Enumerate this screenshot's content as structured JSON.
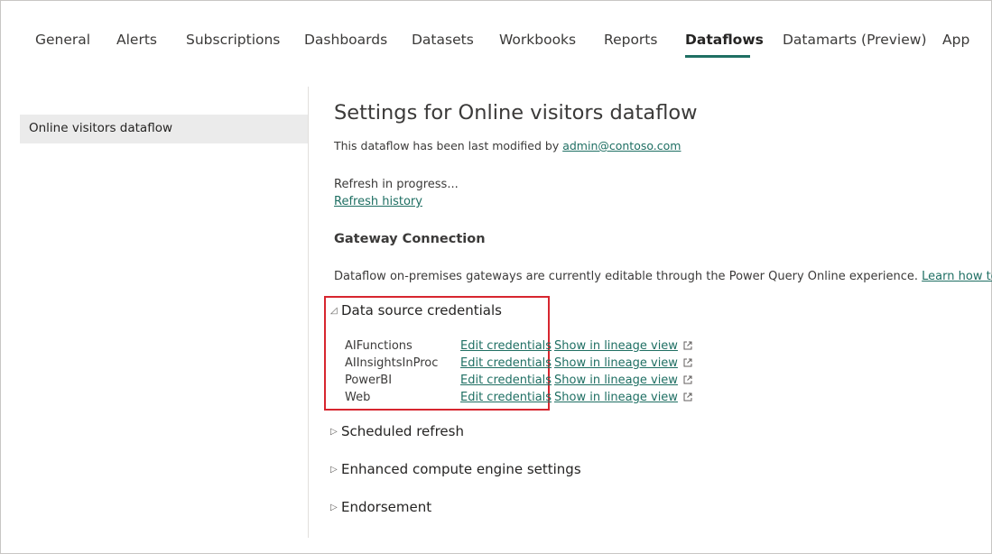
{
  "tabs": [
    {
      "label": "General",
      "active": false
    },
    {
      "label": "Alerts",
      "active": false
    },
    {
      "label": "Subscriptions",
      "active": false
    },
    {
      "label": "Dashboards",
      "active": false
    },
    {
      "label": "Datasets",
      "active": false
    },
    {
      "label": "Workbooks",
      "active": false
    },
    {
      "label": "Reports",
      "active": false
    },
    {
      "label": "Dataflows",
      "active": true
    },
    {
      "label": "Datamarts (Preview)",
      "active": false
    },
    {
      "label": "App",
      "active": false
    }
  ],
  "sidebar": {
    "items": [
      {
        "label": "Online visitors dataflow",
        "selected": true
      }
    ]
  },
  "main": {
    "title": "Settings for Online visitors dataflow",
    "modified_prefix": "This dataflow has been last modified by ",
    "modified_by": "admin@contoso.com",
    "refresh_status": "Refresh in progress...",
    "refresh_history_link": "Refresh history",
    "gateway_heading": "Gateway Connection",
    "gateway_desc": "Dataflow on-premises gateways are currently editable through the Power Query Online experience. ",
    "gateway_link": "Learn how to edit",
    "sections": {
      "credentials": {
        "label": "Data source credentials",
        "expanded": true,
        "caret": "◿"
      },
      "scheduled": {
        "label": "Scheduled refresh",
        "expanded": false,
        "caret": "▷"
      },
      "enhanced": {
        "label": "Enhanced compute engine settings",
        "expanded": false,
        "caret": "▷"
      },
      "endorsement": {
        "label": "Endorsement",
        "expanded": false,
        "caret": "▷"
      }
    },
    "credentials": [
      {
        "name": "AIFunctions",
        "edit_label": "Edit credentials",
        "lineage_label": "Show in lineage view"
      },
      {
        "name": "AIInsightsInProc",
        "edit_label": "Edit credentials",
        "lineage_label": "Show in lineage view"
      },
      {
        "name": "PowerBI",
        "edit_label": "Edit credentials",
        "lineage_label": "Show in lineage view"
      },
      {
        "name": "Web",
        "edit_label": "Edit credentials",
        "lineage_label": "Show in lineage view"
      }
    ]
  },
  "colors": {
    "accent": "#1f6f63",
    "highlight": "#d7262f",
    "sidebar_selected_bg": "#ebebeb"
  },
  "icons": {
    "external_link": "external-link-icon",
    "expanded_caret": "caret-expanded-icon",
    "collapsed_caret": "caret-collapsed-icon"
  }
}
